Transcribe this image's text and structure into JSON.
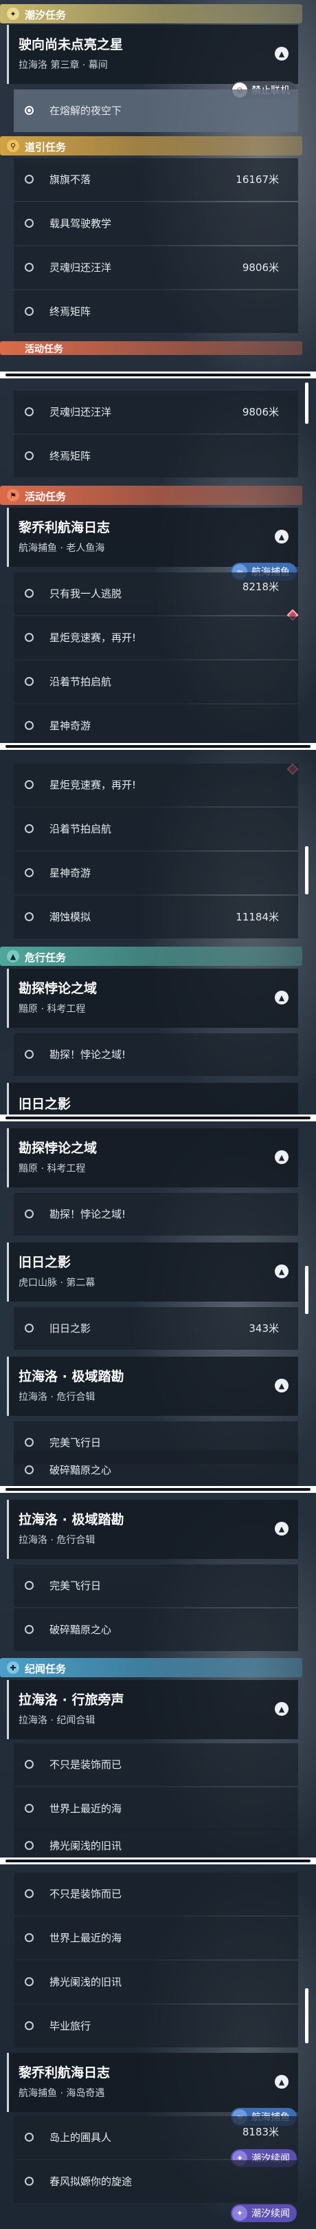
{
  "categories": {
    "chaoxi": "潮汐任务",
    "daoyin": "道引任务",
    "huodong": "活动任务",
    "weixing": "危行任务",
    "jiwen": "纪闻任务"
  },
  "quests": {
    "shi_xiang": {
      "title": "驶向尚未点亮之星",
      "sub": "拉海洛 第三章 · 幕间"
    },
    "liqiao_1": {
      "title": "黎乔利航海日志",
      "sub": "航海捕鱼 · 老人鱼海"
    },
    "kantan": {
      "title": "勘探悖论之域",
      "sub": "黯原 · 科考工程"
    },
    "jiuri": {
      "title": "旧日之影",
      "sub": "虎口山脉 · 第二幕"
    },
    "jiyu": {
      "title": "拉海洛 · 极域踏勘",
      "sub": "拉海洛 · 危行合辑"
    },
    "xingyou": {
      "title": "拉海洛 · 行旅旁声",
      "sub": "拉海洛 · 纪闻合辑"
    },
    "liqiao_2": {
      "title": "黎乔利航海日志",
      "sub": "航海捕鱼 · 海岛奇遇"
    }
  },
  "tasks": {
    "ronglan": {
      "label": "在熔解的夜空下"
    },
    "qizhi": {
      "label": "旗旗不落",
      "dist": "16167米"
    },
    "zaiju": {
      "label": "载具驾驶教学"
    },
    "lingsuo": {
      "label": "灵魂归还汪洋",
      "dist": "9806米"
    },
    "zhongyan": {
      "label": "终焉矩阵"
    },
    "zhiyou": {
      "label": "只有我一人逃脱",
      "dist": "8218米"
    },
    "xingju": {
      "label": "星炬竞速赛，再开!"
    },
    "yanjie": {
      "label": "沿着节拍启航"
    },
    "xingshen": {
      "label": "星神奇游"
    },
    "chaoshi": {
      "label": "潮蚀模拟",
      "dist": "11184米"
    },
    "kanbao": {
      "label": "勘探！悖论之域!"
    },
    "jiuriying": {
      "label": "旧日之影",
      "dist": "343米"
    },
    "wanmei": {
      "label": "完美飞行日"
    },
    "posui": {
      "label": "破碎黯原之心"
    },
    "bushi": {
      "label": "不只是装饰而已"
    },
    "shijie": {
      "label": "世界上最近的海"
    },
    "fuguang": {
      "label": "拂光阑浅的旧讯"
    },
    "biye": {
      "label": "毕业旅行"
    },
    "daoshang": {
      "label": "岛上的圃具人",
      "dist": "8183米"
    },
    "chunfeng": {
      "label": "春风拟嫄你的旋途"
    }
  },
  "tags": {
    "forbidden": "禁止联机",
    "fishing": "航海捕鱼",
    "chaoxi_tag": "潮汐续闻"
  },
  "icons": {
    "chaoxi": "star-icon",
    "daoyin": "pin-icon",
    "huodong": "flag-icon",
    "weixing": "triangle-icon",
    "jiwen": "book-icon"
  },
  "colors": {
    "chaoxi": "#c9b86c",
    "daoyin": "#d1a245",
    "huodong": "#dc6a4a",
    "weixing": "#50a79c",
    "jiwen": "#4aa0c8",
    "tag_fish": "#3d6fb8",
    "tag_chaoxi": "#5b4fb3",
    "diamond": "#d6455a"
  }
}
